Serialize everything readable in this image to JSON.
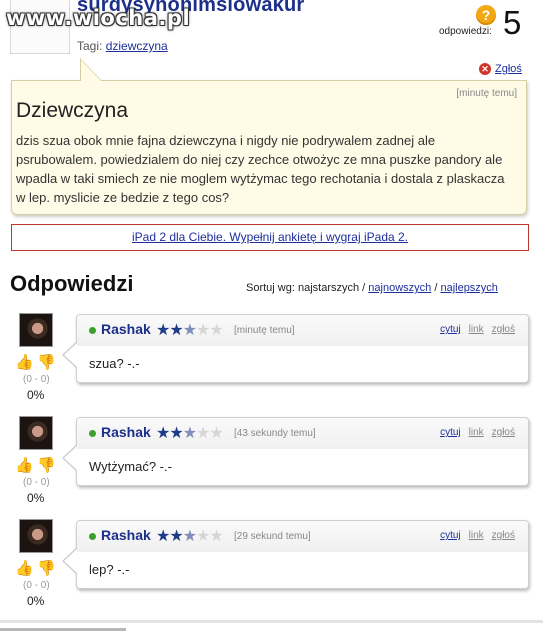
{
  "watermark": "www.wiocha.pl",
  "question": {
    "title": "surdysynonimslowakur",
    "tags_label": "Tagi:",
    "tag": "dziewczyna",
    "answers_label": "odpowiedzi:",
    "answers_count": "5",
    "qmark": "?",
    "report": "Zgłoś",
    "time": "[minutę temu]",
    "heading": "Dziewczyna",
    "body": "dzis szua obok mnie fajna dziewczyna i nigdy nie podrywalem zadnej ale psrubowalem. powiedzialem do niej czy zechce otwożyc ze mna puszke pandory ale wpadla w taki smiech ze nie moglem wytżymac tego rechotania i dostala z plaskacza w lep. myslicie ze bedzie z tego cos?"
  },
  "ad": {
    "text": "iPad 2 dla Ciebie. Wypełnij ankietę i wygraj iPada 2."
  },
  "answers_section": {
    "heading": "Odpowiedzi",
    "sort_label": "Sortuj wg: najstarszych /",
    "sort_newest": "najnowszych",
    "sort_sep": "/",
    "sort_best": "najlepszych"
  },
  "answers": [
    {
      "user": "Rashak",
      "rating": 2.5,
      "time": "[minutę temu]",
      "text": "szua? -.-",
      "score": "(0 - 0)",
      "percent": "0%",
      "cite": "cytuj",
      "link": "link",
      "report": "zgłoś"
    },
    {
      "user": "Rashak",
      "rating": 2.5,
      "time": "[43 sekundy temu]",
      "text": "Wytżymać? -.-",
      "score": "(0 - 0)",
      "percent": "0%",
      "cite": "cytuj",
      "link": "link",
      "report": "zgłoś"
    },
    {
      "user": "Rashak",
      "rating": 2.5,
      "time": "[29 sekund temu]",
      "text": "lep? -.-",
      "score": "(0 - 0)",
      "percent": "0%",
      "cite": "cytuj",
      "link": "link",
      "report": "zgłoś"
    }
  ],
  "icons": {
    "thumb_up": "thumbs-up-icon",
    "thumb_down": "thumbs-down-icon",
    "report": "close-icon",
    "online": "online-dot-icon"
  },
  "colors": {
    "link": "#1d2f9c",
    "title": "#1c2f8a",
    "question_bg": "#fffbe6",
    "ad_border": "#c0392b",
    "star": "#1f3c88"
  }
}
